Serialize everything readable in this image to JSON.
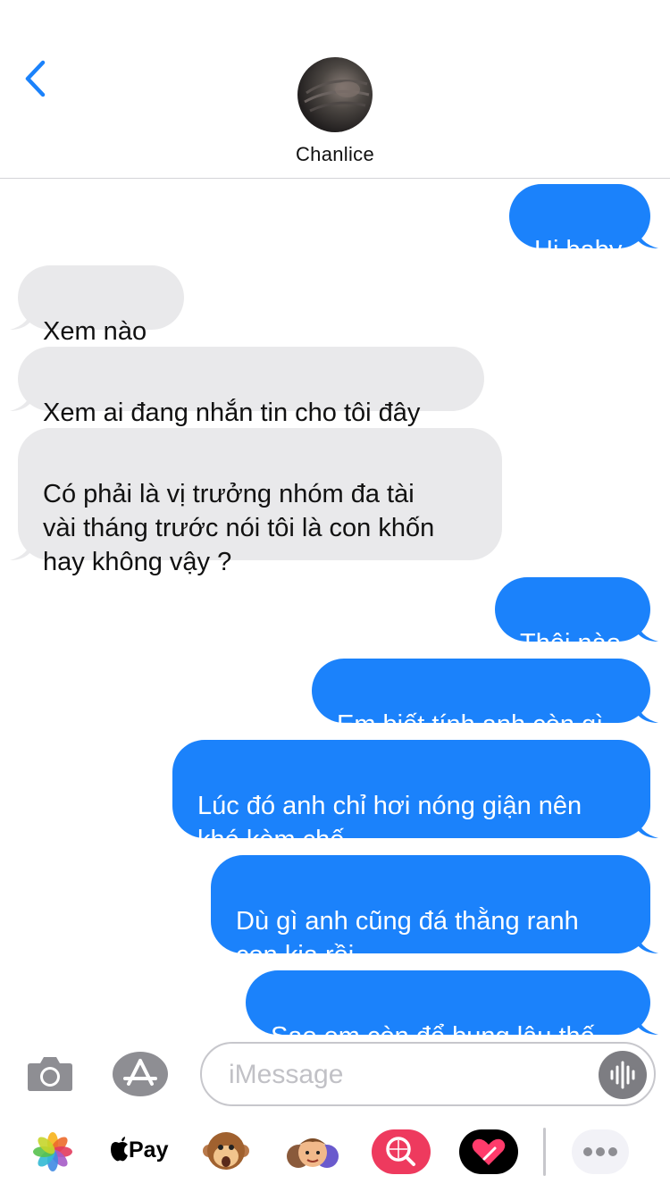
{
  "status_bar": {
    "battery_color": "#f5d21b"
  },
  "header": {
    "contact_name": "Chanlice"
  },
  "messages": [
    {
      "dir": "out",
      "text": "Hi baby"
    },
    {
      "dir": "in",
      "text": "Xem nào"
    },
    {
      "dir": "in",
      "text": "Xem ai đang nhắn tin cho tôi đây"
    },
    {
      "dir": "in",
      "text": "Có phải là vị trưởng nhóm đa tài\nvài tháng trước nói tôi là con khốn\nhay không vậy ?"
    },
    {
      "dir": "out",
      "text": "Thôi nào"
    },
    {
      "dir": "out",
      "text": "Em biết tính anh còn gì"
    },
    {
      "dir": "out",
      "text": "Lúc đó anh chỉ hơi nóng giận nên\nkhó kèm chế"
    },
    {
      "dir": "out",
      "text": "Dù gì anh cũng đá thằng ranh\ncon kia rồi"
    },
    {
      "dir": "out",
      "text": "Sao em còn để bụng lâu thế"
    }
  ],
  "composer": {
    "placeholder": "iMessage"
  },
  "app_drawer": {
    "items": [
      "photos-icon",
      "apple-pay-icon",
      "monkey-memoji-icon",
      "memoji-stickers-icon",
      "images-search-icon",
      "digital-touch-icon",
      "more-icon"
    ],
    "apple_pay_label": "Pay"
  },
  "colors": {
    "outgoing": "#1b82fb",
    "incoming": "#e9e9eb",
    "accent": "#1b82fb"
  }
}
